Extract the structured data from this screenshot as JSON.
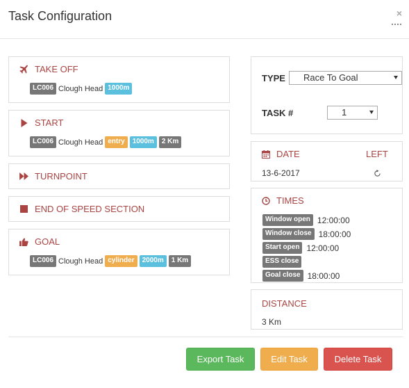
{
  "modal": {
    "title": "Task Configuration",
    "close_label": "×"
  },
  "turnpoints": [
    {
      "label": "TAKE OFF",
      "icon": "plane-icon",
      "badges": [
        {
          "text": "LC006",
          "color": "grey"
        },
        {
          "place": "Clough Head"
        },
        {
          "text": "1000m",
          "color": "blue"
        }
      ]
    },
    {
      "label": "START",
      "icon": "play-icon",
      "badges": [
        {
          "text": "LC006",
          "color": "grey"
        },
        {
          "place": "Clough Head"
        },
        {
          "text": "entry",
          "color": "orange"
        },
        {
          "text": "1000m",
          "color": "blue"
        },
        {
          "text": "2 Km",
          "color": "grey"
        }
      ]
    },
    {
      "label": "TURNPOINT",
      "icon": "fast-forward-icon"
    },
    {
      "label": "END OF SPEED SECTION",
      "icon": "stop-square-icon"
    },
    {
      "label": "GOAL",
      "icon": "thumbs-up-icon",
      "badges": [
        {
          "text": "LC006",
          "color": "grey"
        },
        {
          "place": "Clough Head"
        },
        {
          "text": "cylinder",
          "color": "orange"
        },
        {
          "text": "2000m",
          "color": "blue"
        },
        {
          "text": "1 Km",
          "color": "grey"
        }
      ]
    }
  ],
  "settings": {
    "type_label": "TYPE",
    "type_value": "Race To Goal",
    "task_label": "TASK #",
    "task_value": "1"
  },
  "date": {
    "label": "DATE",
    "left_label": "LEFT",
    "value": "13-6-2017",
    "refresh_icon": "refresh-icon"
  },
  "times": {
    "label": "TIMES",
    "rows": [
      {
        "badge": "Window open",
        "value": "12:00:00"
      },
      {
        "badge": "Window close",
        "value": "18:00:00"
      },
      {
        "badge": "Start open",
        "value": "12:00:00"
      },
      {
        "badge": "ESS close",
        "value": ""
      },
      {
        "badge": "Goal close",
        "value": "18:00:00"
      }
    ]
  },
  "distance": {
    "label": "DISTANCE",
    "value": "3 Km"
  },
  "buttons": {
    "export": "Export Task",
    "edit": "Edit Task",
    "delete": "Delete Task"
  },
  "colors": {
    "heading_red": "#a94442",
    "green": "#5cb85c",
    "amber": "#f0ad4e",
    "red": "#d9534f",
    "badge_grey": "#777777",
    "badge_blue": "#5bc0de",
    "badge_orange": "#f0ad4e"
  }
}
